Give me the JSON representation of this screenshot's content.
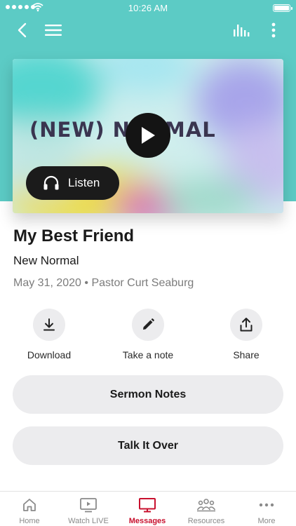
{
  "status_bar": {
    "time": "10:26 AM",
    "signal_icon": "signal-dots-icon",
    "wifi_icon": "wifi-icon",
    "battery_icon": "battery-icon"
  },
  "nav": {
    "back_icon": "chevron-left-icon",
    "menu_icon": "hamburger-menu-icon",
    "audio_icon": "audio-bars-icon",
    "more_icon": "vertical-dots-icon"
  },
  "artwork": {
    "text": "(NEW) NORMAL",
    "play_icon": "play-icon"
  },
  "listen_button": {
    "label": "Listen",
    "icon": "headphones-icon"
  },
  "sermon": {
    "title": "My Best Friend",
    "series": "New Normal",
    "meta": "May 31, 2020 • Pastor Curt Seaburg"
  },
  "actions": [
    {
      "label": "Download",
      "icon": "download-icon"
    },
    {
      "label": "Take a note",
      "icon": "pencil-icon"
    },
    {
      "label": "Share",
      "icon": "share-icon"
    }
  ],
  "buttons": {
    "sermon_notes": "Sermon Notes",
    "talk_it_over": "Talk It Over"
  },
  "tabs": [
    {
      "label": "Home",
      "icon": "home-icon",
      "active": false
    },
    {
      "label": "Watch LIVE",
      "icon": "tv-play-icon",
      "active": false
    },
    {
      "label": "Messages",
      "icon": "monitor-icon",
      "active": true
    },
    {
      "label": "Resources",
      "icon": "group-icon",
      "active": false
    },
    {
      "label": "More",
      "icon": "horizontal-dots-icon",
      "active": false
    }
  ],
  "colors": {
    "header_teal": "#5ccbc5",
    "active_tab": "#c8102e",
    "button_gray": "#ececee",
    "dark_button": "#1b1b1b"
  }
}
